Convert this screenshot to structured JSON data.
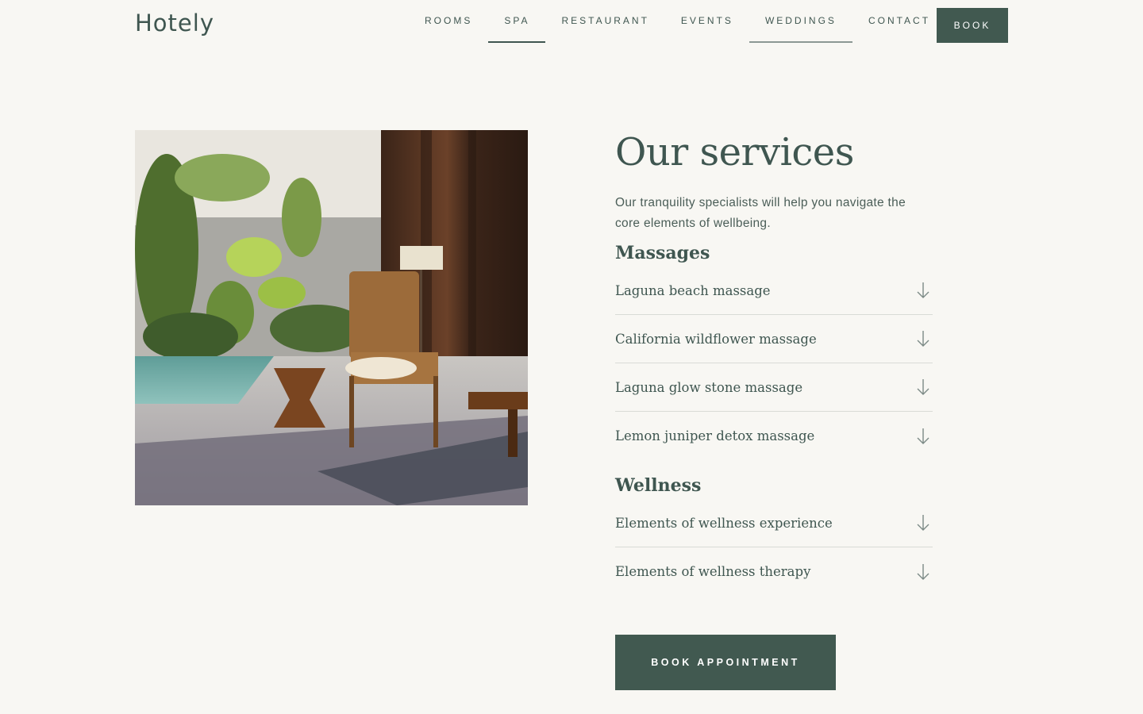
{
  "header": {
    "logo": "Hotely",
    "nav": [
      {
        "label": "ROOMS",
        "state": "default"
      },
      {
        "label": "SPA",
        "state": "active"
      },
      {
        "label": "RESTAURANT",
        "state": "default"
      },
      {
        "label": "EVENTS",
        "state": "default"
      },
      {
        "label": "WEDDINGS",
        "state": "hover"
      },
      {
        "label": "CONTACT",
        "state": "default"
      }
    ],
    "book_label": "BOOK"
  },
  "main": {
    "title": "Our services",
    "intro": "Our tranquility specialists will help you navigate the core elements of wellbeing.",
    "sections": [
      {
        "heading": "Massages",
        "items": [
          "Laguna beach massage",
          "California wildflower massage",
          "Laguna glow stone massage",
          "Lemon juniper detox massage"
        ]
      },
      {
        "heading": "Wellness",
        "items": [
          "Elements of wellness experience",
          "Elements of wellness therapy"
        ]
      }
    ],
    "cta_label": "BOOK APPOINTMENT"
  },
  "colors": {
    "background": "#f8f7f3",
    "brand": "#415950",
    "text": "#3f5650",
    "divider": "#d9dbd6"
  },
  "icons": {
    "accordion": "arrow-down-icon"
  }
}
